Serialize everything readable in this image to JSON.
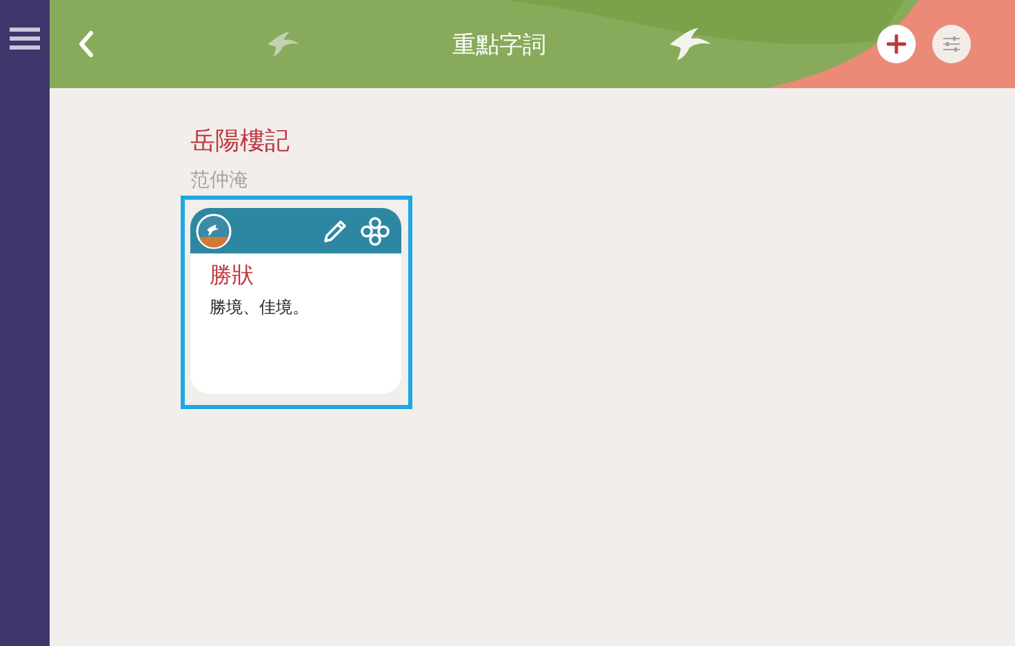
{
  "header": {
    "title": "重點字詞"
  },
  "article": {
    "title": "岳陽樓記",
    "author": "范仲淹"
  },
  "cards": [
    {
      "term": "勝狀",
      "definition": "勝境、佳境。",
      "selected": true
    }
  ]
}
